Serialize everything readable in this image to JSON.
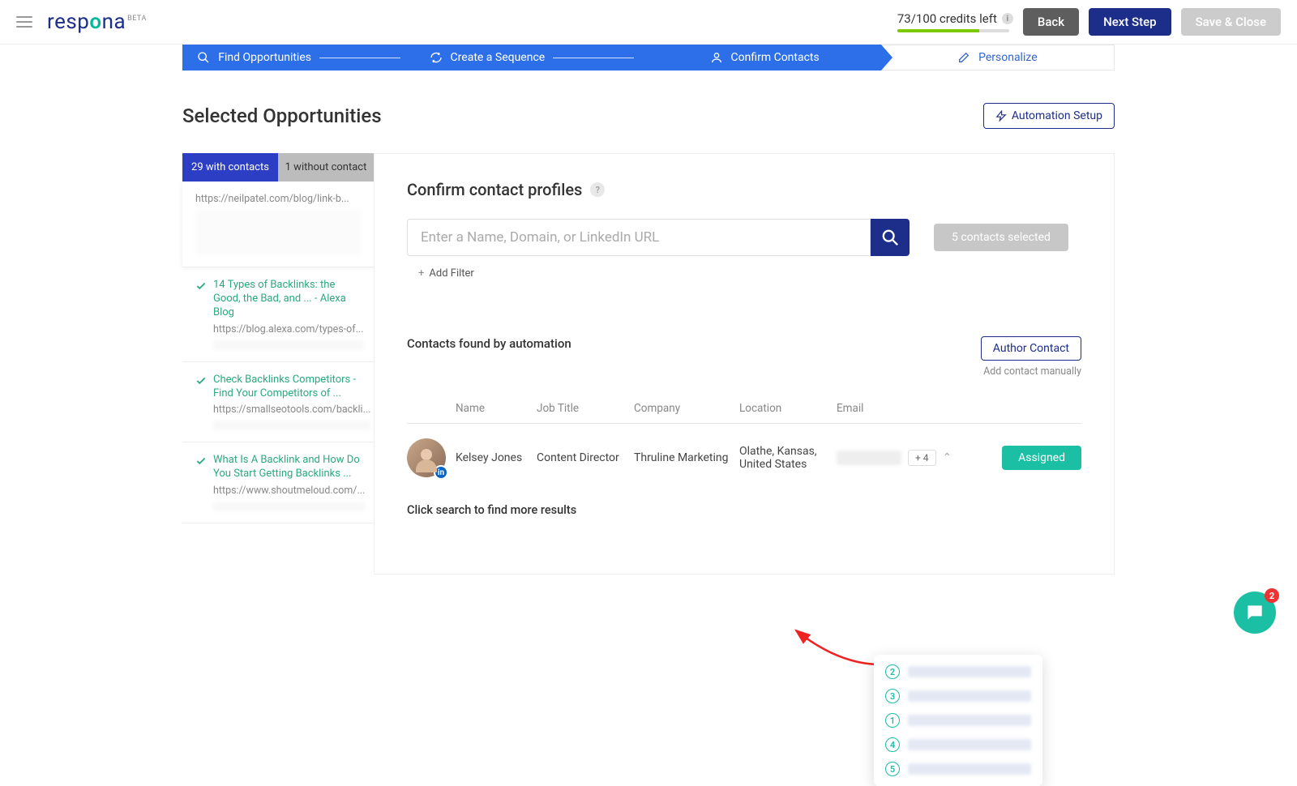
{
  "header": {
    "logo_text": "respona",
    "logo_suffix": "BETA",
    "credits_text": "73/100 credits left",
    "back": "Back",
    "next": "Next Step",
    "save": "Save & Close"
  },
  "wizard": {
    "step1": "Find Opportunities",
    "step2": "Create a Sequence",
    "step3": "Confirm Contacts",
    "step4": "Personalize"
  },
  "page": {
    "title": "Selected Opportunities",
    "automation_btn": "Automation Setup"
  },
  "tabs": {
    "with": "29 with contacts",
    "without": "1 without contact"
  },
  "opps": {
    "item0_url": "https://neilpatel.com/blog/link-b...",
    "item1_title": "14 Types of Backlinks: the Good, the Bad, and ... - Alexa Blog",
    "item1_url": "https://blog.alexa.com/types-of...",
    "item2_title": "Check Backlinks Competitors - Find Your Competitors of ...",
    "item2_url": "https://smallseotools.com/backli...",
    "item3_title": "What Is A Backlink and How Do You Start Getting Backlinks ...",
    "item3_url": "https://www.shoutmeloud.com/..."
  },
  "confirm": {
    "title": "Confirm contact profiles",
    "placeholder": "Enter a Name, Domain, or LinkedIn URL",
    "selected_pill": "5 contacts selected",
    "add_filter": "Add Filter",
    "found_title": "Contacts found by automation",
    "author_btn": "Author Contact",
    "add_manual": "Add contact manually",
    "cols": {
      "name": "Name",
      "job": "Job Title",
      "company": "Company",
      "location": "Location",
      "email": "Email"
    },
    "row": {
      "name": "Kelsey Jones",
      "job": "Content Director",
      "company": "Thruline Marketing",
      "location": "Olathe, Kansas, United States",
      "plus": "+ 4",
      "assigned": "Assigned",
      "li": "in"
    },
    "hint": "Click search to find more results"
  },
  "dropdown_numbers": [
    "2",
    "3",
    "1",
    "4",
    "5"
  ],
  "chat_badge": "2"
}
